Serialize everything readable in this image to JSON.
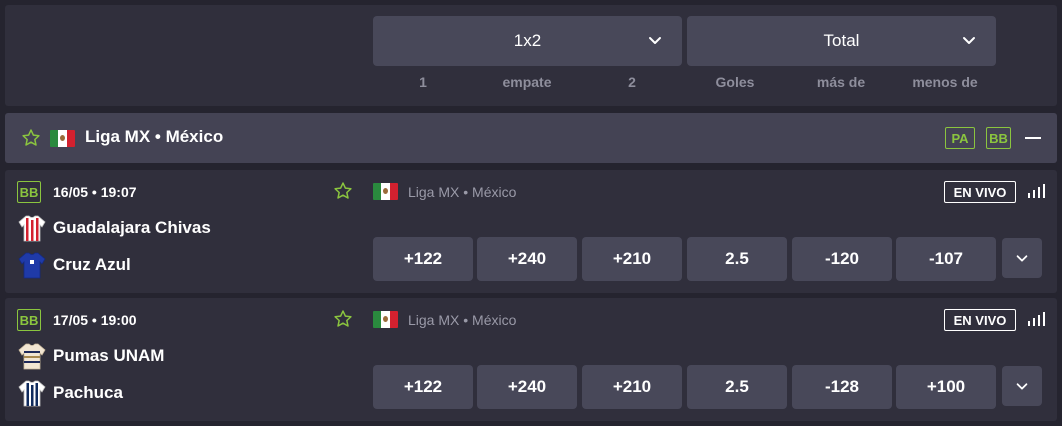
{
  "header": {
    "market_select_1": "1x2",
    "market_select_2": "Total",
    "col_1": "1",
    "col_draw": "empate",
    "col_2": "2",
    "col_goals": "Goles",
    "col_over": "más de",
    "col_under": "menos de"
  },
  "league": {
    "title": "Liga MX • México",
    "tag_pa": "PA",
    "tag_bb": "BB"
  },
  "matches": [
    {
      "badge": "BB",
      "datetime": "16/05 • 19:07",
      "league": "Liga MX • México",
      "live": "EN VIVO",
      "home": "Guadalajara Chivas",
      "away": "Cruz Azul",
      "odds": [
        "+122",
        "+240",
        "+210",
        "2.5",
        "-120",
        "-107"
      ]
    },
    {
      "badge": "BB",
      "datetime": "17/05 • 19:00",
      "league": "Liga MX • México",
      "live": "EN VIVO",
      "home": "Pumas UNAM",
      "away": "Pachuca",
      "odds": [
        "+122",
        "+240",
        "+210",
        "2.5",
        "-128",
        "+100"
      ]
    }
  ],
  "colors": {
    "background": "#25242f",
    "panel": "#302f3c",
    "league_bar": "#444354",
    "button": "#484859",
    "accent_green": "#8bc53f",
    "muted_text": "#8e8e9c"
  }
}
